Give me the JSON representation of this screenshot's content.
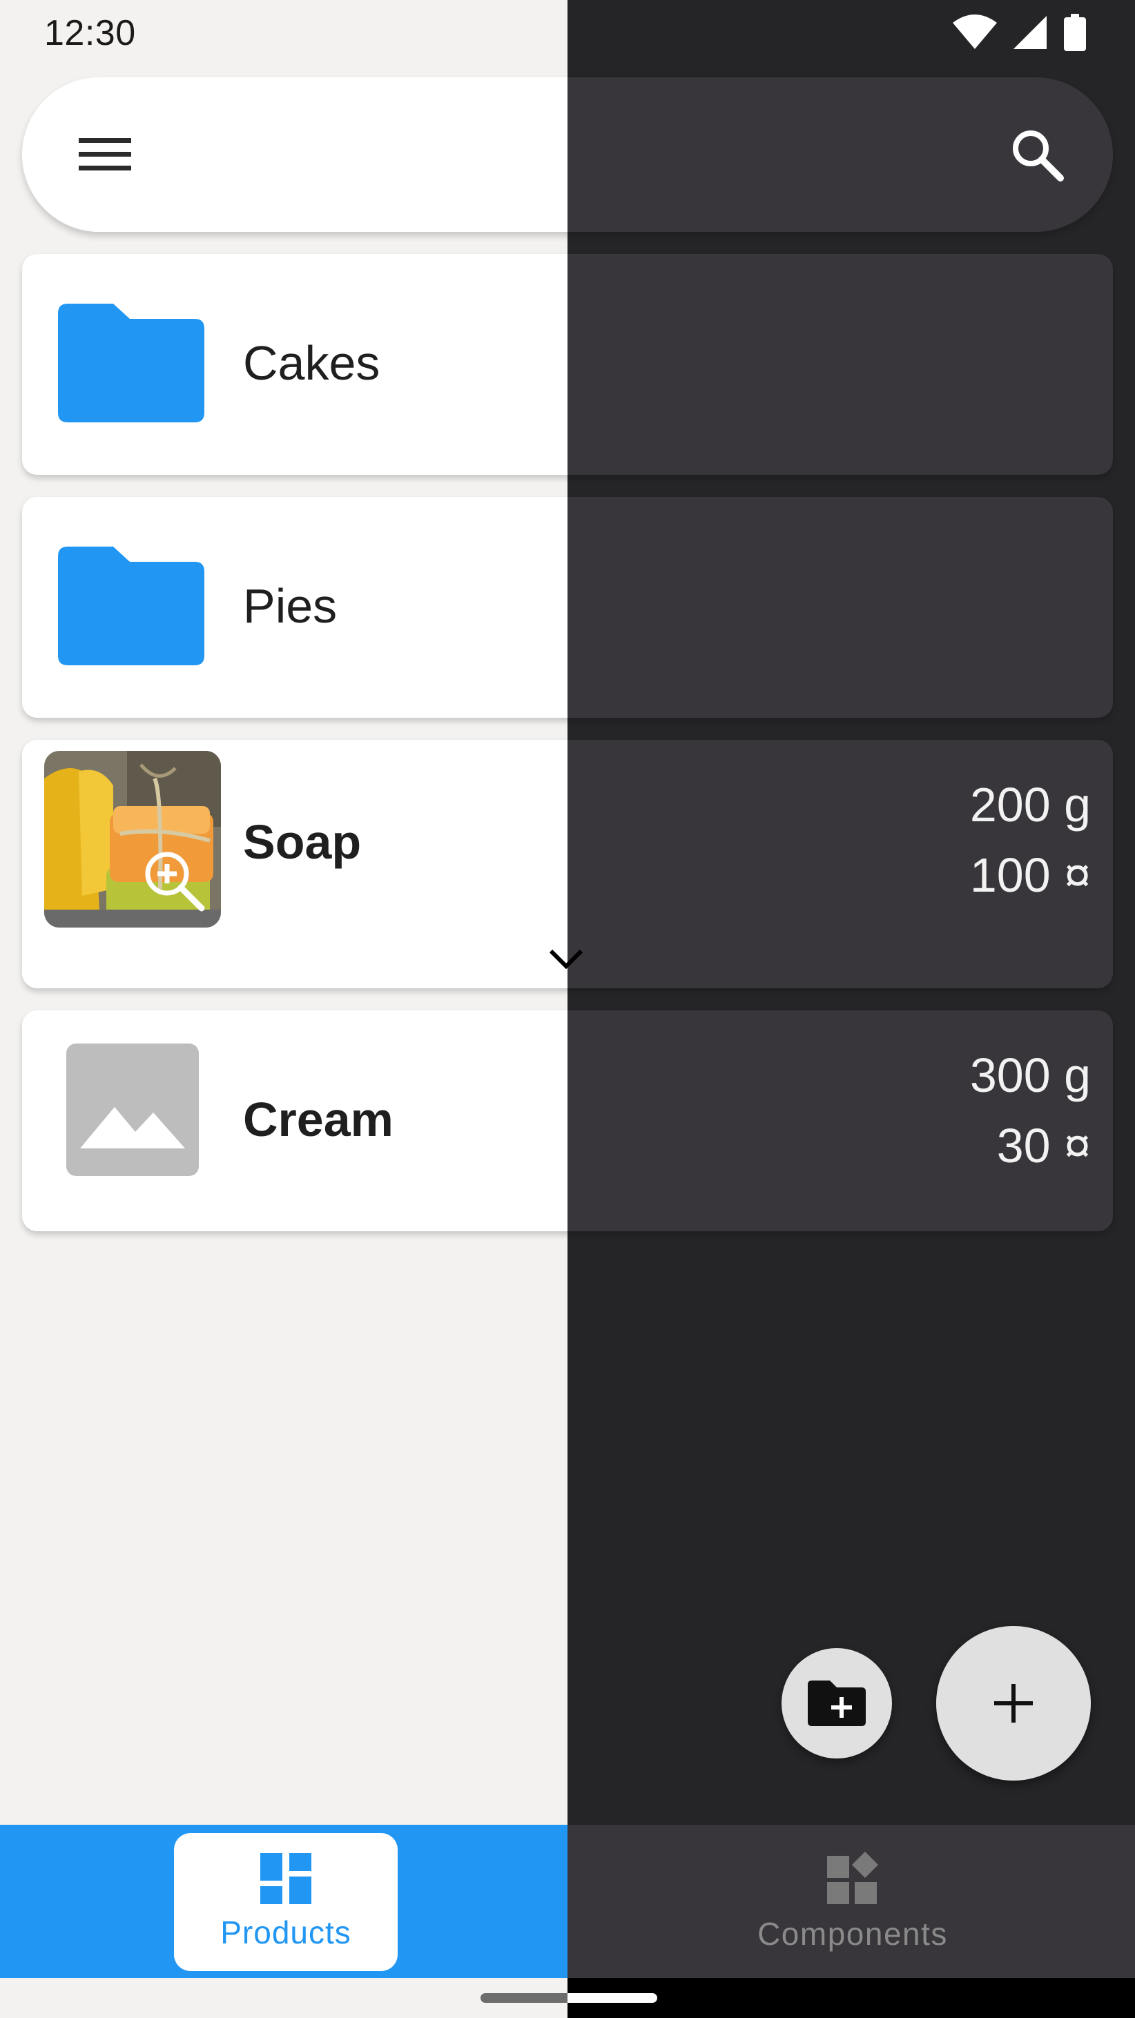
{
  "status_bar": {
    "time": "12:30",
    "icons": [
      "wifi-icon",
      "cell-signal-icon",
      "battery-icon"
    ]
  },
  "search_bar": {
    "menu_icon": "menu-icon",
    "search_icon": "search-icon"
  },
  "items": [
    {
      "type": "folder",
      "name": "Cakes"
    },
    {
      "type": "folder",
      "name": "Pies"
    },
    {
      "type": "product",
      "name": "Soap",
      "weight": "200 g",
      "price": "100 ¤",
      "image": "photo",
      "expand_icon": "chevron-down-icon"
    },
    {
      "type": "product",
      "name": "Cream",
      "weight": "300 g",
      "price": "30 ¤",
      "image": "placeholder"
    }
  ],
  "fabs": {
    "add_folder_icon": "create-folder-icon",
    "add_icon": "add-icon"
  },
  "bottom_nav": {
    "products_label": "Products",
    "components_label": "Components",
    "selected": "Products"
  },
  "colors": {
    "accent": "#2196f3",
    "light_bg": "#f3f2f0",
    "dark_bg": "#252427",
    "dark_card": "#38363b"
  }
}
